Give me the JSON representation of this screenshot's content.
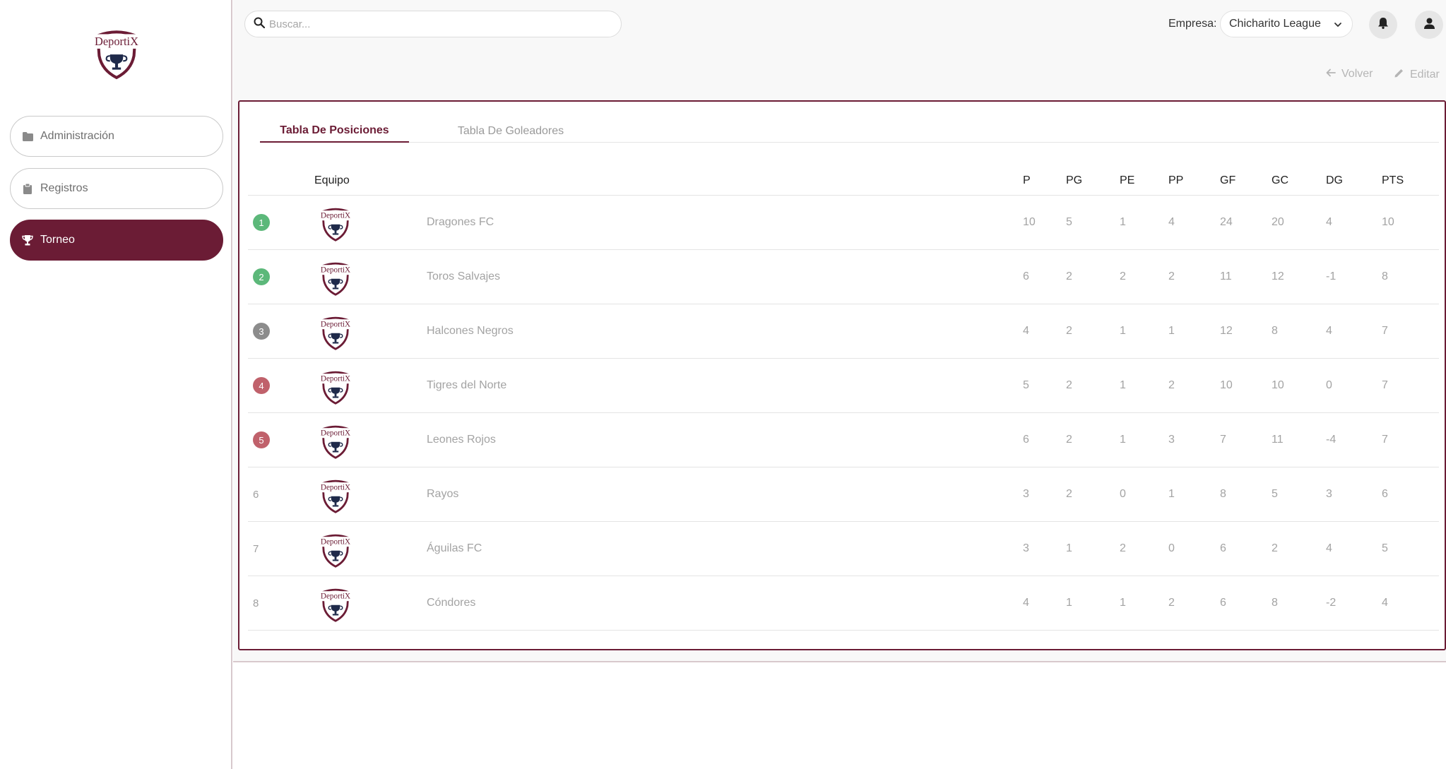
{
  "brand": {
    "logo_text": "DeportiX",
    "primary_color": "#6b1c35"
  },
  "sidebar": {
    "items": [
      {
        "label": "Administración",
        "icon": "folder-icon",
        "active": false
      },
      {
        "label": "Registros",
        "icon": "clipboard-icon",
        "active": false
      },
      {
        "label": "Torneo",
        "icon": "trophy-icon",
        "active": true
      }
    ]
  },
  "topbar": {
    "search_placeholder": "Buscar...",
    "empresa_label": "Empresa:",
    "empresa_value": "Chicharito League"
  },
  "actions": {
    "back_label": "Volver",
    "edit_label": "Editar"
  },
  "tabs": [
    {
      "label": "Tabla De Posiciones",
      "active": true
    },
    {
      "label": "Tabla De Goleadores",
      "active": false
    }
  ],
  "table": {
    "columns": [
      "Equipo",
      "P",
      "PG",
      "PE",
      "PP",
      "GF",
      "GC",
      "DG",
      "PTS"
    ],
    "rows": [
      {
        "pos": "1",
        "badge": "#5cb87a",
        "team": "Dragones FC",
        "P": "10",
        "PG": "5",
        "PE": "1",
        "PP": "4",
        "GF": "24",
        "GC": "20",
        "DG": "4",
        "PTS": "10"
      },
      {
        "pos": "2",
        "badge": "#5cb87a",
        "team": "Toros Salvajes",
        "P": "6",
        "PG": "2",
        "PE": "2",
        "PP": "2",
        "GF": "11",
        "GC": "12",
        "DG": "-1",
        "PTS": "8"
      },
      {
        "pos": "3",
        "badge": "#8c8c8c",
        "team": "Halcones Negros",
        "P": "4",
        "PG": "2",
        "PE": "1",
        "PP": "1",
        "GF": "12",
        "GC": "8",
        "DG": "4",
        "PTS": "7"
      },
      {
        "pos": "4",
        "badge": "#c0616b",
        "team": "Tigres del Norte",
        "P": "5",
        "PG": "2",
        "PE": "1",
        "PP": "2",
        "GF": "10",
        "GC": "10",
        "DG": "0",
        "PTS": "7"
      },
      {
        "pos": "5",
        "badge": "#c0616b",
        "team": "Leones Rojos",
        "P": "6",
        "PG": "2",
        "PE": "1",
        "PP": "3",
        "GF": "7",
        "GC": "11",
        "DG": "-4",
        "PTS": "7"
      },
      {
        "pos": "6",
        "badge": "",
        "team": "Rayos",
        "P": "3",
        "PG": "2",
        "PE": "0",
        "PP": "1",
        "GF": "8",
        "GC": "5",
        "DG": "3",
        "PTS": "6"
      },
      {
        "pos": "7",
        "badge": "",
        "team": "Águilas FC",
        "P": "3",
        "PG": "1",
        "PE": "2",
        "PP": "0",
        "GF": "6",
        "GC": "2",
        "DG": "4",
        "PTS": "5"
      },
      {
        "pos": "8",
        "badge": "",
        "team": "Cóndores",
        "P": "4",
        "PG": "1",
        "PE": "1",
        "PP": "2",
        "GF": "6",
        "GC": "8",
        "DG": "-2",
        "PTS": "4"
      }
    ]
  }
}
